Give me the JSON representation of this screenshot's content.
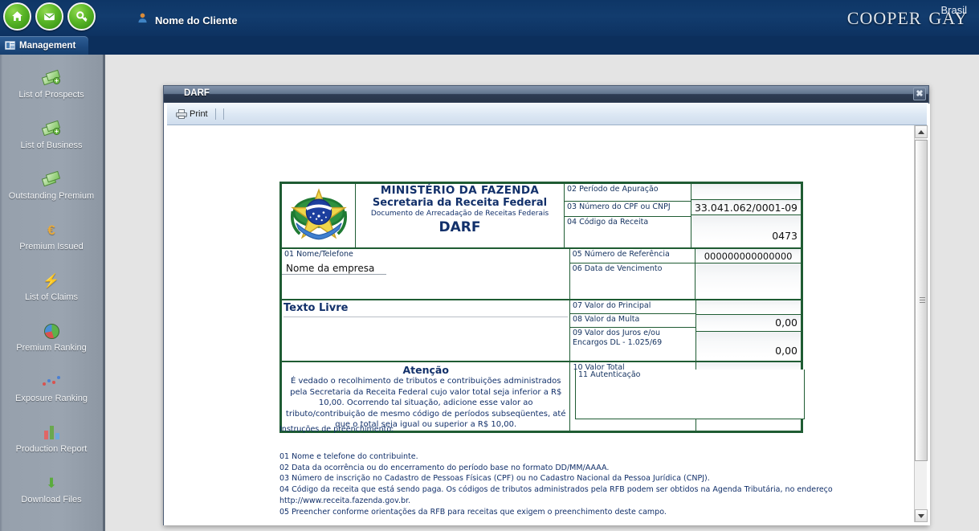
{
  "header": {
    "client_name": "Nome do Cliente",
    "logo_main": "Cooper Gay",
    "logo_sup": "Brasil",
    "icons": [
      "home-icon",
      "mail-icon",
      "key-icon"
    ]
  },
  "tabs": [
    {
      "label": "Management",
      "icon": "list-icon",
      "active": true
    }
  ],
  "sidebar": {
    "items": [
      {
        "label": "List of Prospects",
        "icon": "money-add-icon"
      },
      {
        "label": "List of Business",
        "icon": "money-add-icon"
      },
      {
        "label": "Outstanding Premium",
        "icon": "money-icon"
      },
      {
        "label": "Premium Issued",
        "icon": "euro-icon"
      },
      {
        "label": "List of Claims",
        "icon": "lightning-icon"
      },
      {
        "label": "Premium Ranking",
        "icon": "pie-chart-icon"
      },
      {
        "label": "Exposure Ranking",
        "icon": "scatter-chart-icon"
      },
      {
        "label": "Production Report",
        "icon": "bar-chart-icon"
      },
      {
        "label": "Download Files",
        "icon": "download-arrow-icon"
      }
    ]
  },
  "window": {
    "title": "DARF",
    "close_label": "✖",
    "toolbar": {
      "print_label": "Print",
      "print_icon": "printer-icon"
    }
  },
  "darf": {
    "header": {
      "line1": "MINISTÉRIO DA FAZENDA",
      "line2": "Secretaria da Receita Federal",
      "line3": "Documento de Arrecadação de Receitas Federais",
      "line4": "DARF"
    },
    "field01": {
      "label": "01 Nome/Telefone",
      "value": "Nome da empresa"
    },
    "field02": {
      "label": "02 Período de Apuração",
      "value": ""
    },
    "field03": {
      "label": "03 Número do CPF ou CNPJ",
      "value": "33.041.062/0001-09"
    },
    "field04": {
      "label": "04 Código da Receita",
      "value": "0473"
    },
    "field05": {
      "label": "05 Número de Referência",
      "value": "000000000000000"
    },
    "field06": {
      "label": "06 Data de Vencimento",
      "value": ""
    },
    "field07": {
      "label": "07 Valor do Principal",
      "value": ""
    },
    "field08": {
      "label": "08 Valor da Multa",
      "value": "0,00"
    },
    "field09": {
      "label": "09 Valor dos Juros e/ou Encargos DL - 1.025/69",
      "value": "0,00"
    },
    "field10": {
      "label": "10 Valor Total",
      "value": ""
    },
    "field11": {
      "label": "11 Autenticação",
      "value": ""
    },
    "texto_livre_title": "Texto Livre",
    "atencao_title": "Atenção",
    "atencao_text": "É vedado o recolhimento de tributos e contribuições administrados pela Secretaria da Receita Federal cujo valor total seja inferior a R$ 10,00. Ocorrendo tal situação, adicione esse valor ao tributo/contribuição de mesmo código de períodos subseqüentes, até que o total seja igual ou superior a R$ 10,00."
  },
  "instructions": {
    "title": "Instruções de preenchimento:",
    "lines": [
      "01 Nome e telefone do contribuinte.",
      "02 Data da ocorrência ou do encerramento do período base no formato DD/MM/AAAA.",
      "03 Número de inscrição no Cadastro de Pessoas Físicas (CPF) ou no Cadastro Nacional da Pessoa Jurídica (CNPJ).",
      "04 Código da receita que está sendo paga. Os códigos de tributos administrados pela RFB podem ser obtidos na Agenda Tributária, no endereço http://www.receita.fazenda.gov.br.",
      "05 Preencher conforme orientações da RFB para receitas que exigem o preenchimento deste campo."
    ]
  },
  "colors": {
    "header_navy": "#123c6e",
    "sidebar_gray": "#9aa4b0",
    "form_green_border": "#1f5c33",
    "form_blue_text": "#12306a",
    "accent_green": "#5cb828"
  }
}
